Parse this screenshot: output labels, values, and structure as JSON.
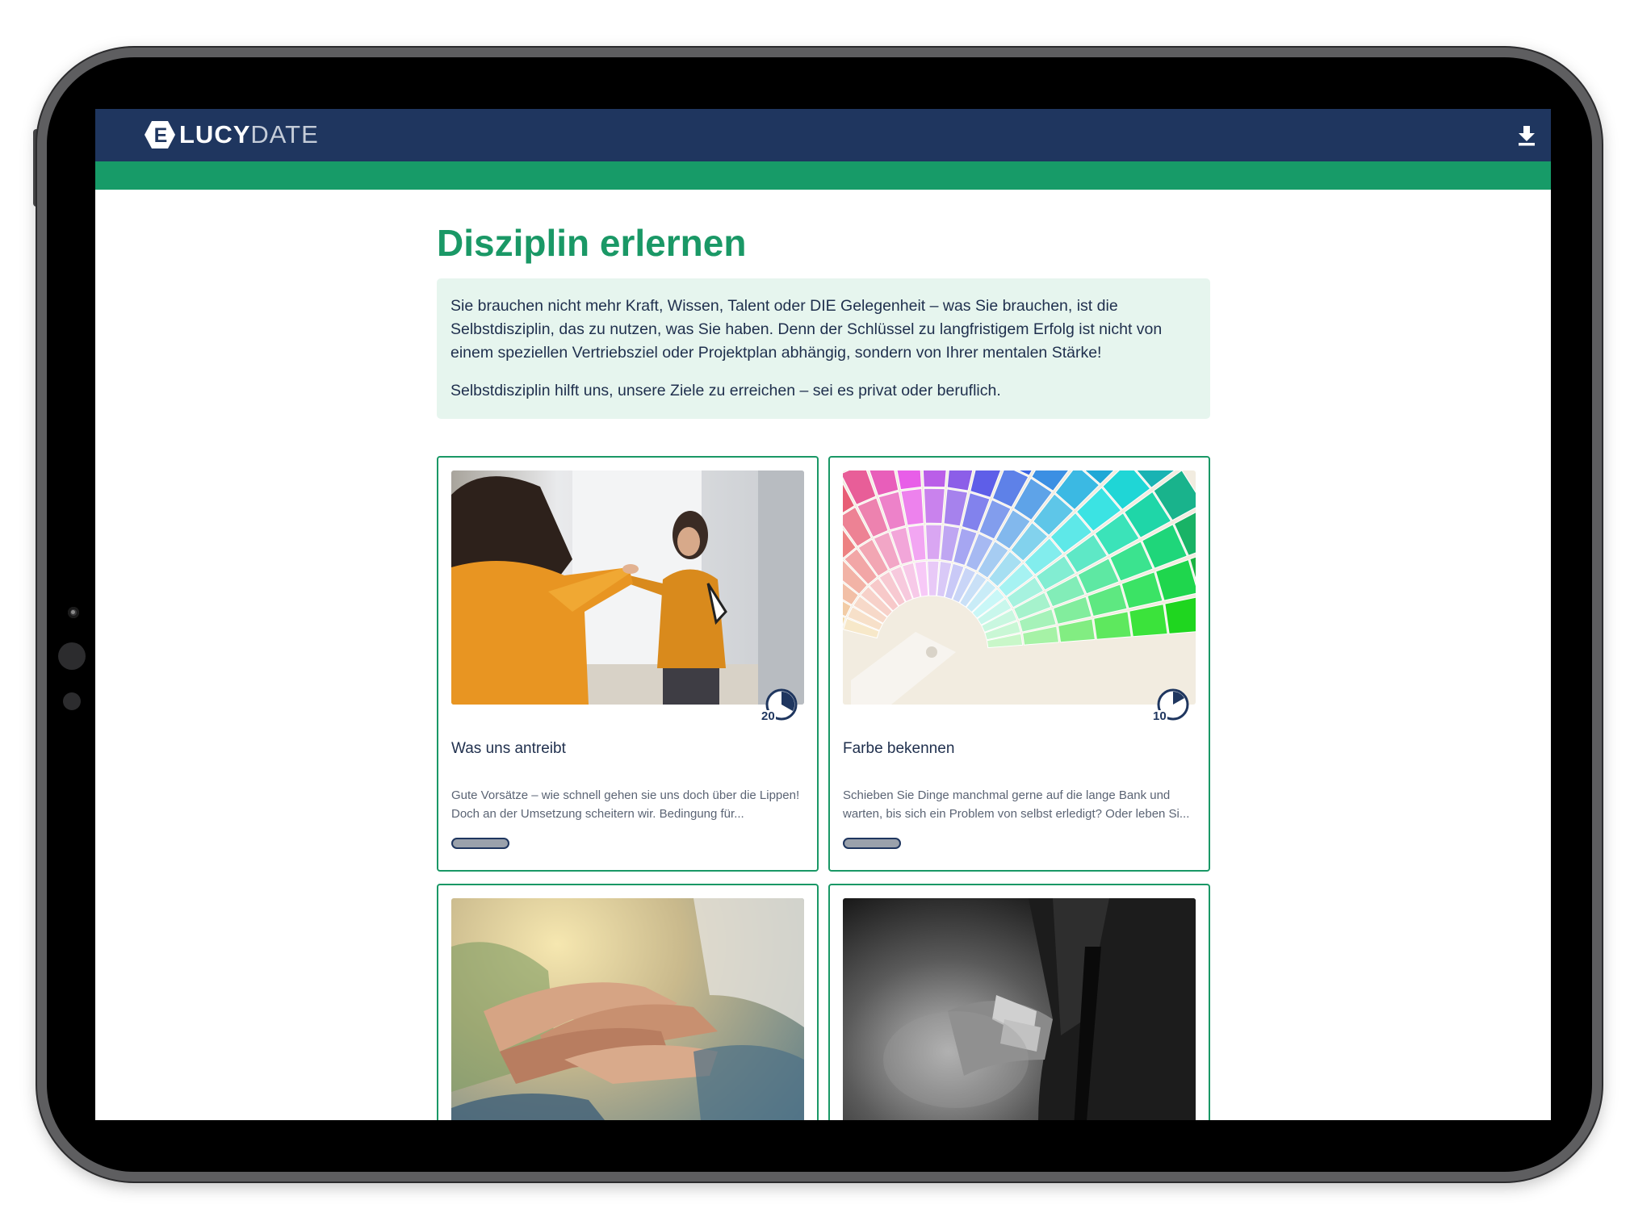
{
  "header": {
    "logo_letter": "E",
    "logo_part1": "LUCY",
    "logo_part2": "DATE",
    "download_icon": "download-icon"
  },
  "colors": {
    "header_bg": "#1f365f",
    "accent_green": "#179b68",
    "intro_bg": "#e6f5ee",
    "text_dark": "#1f2f4d"
  },
  "page": {
    "title": "Disziplin erlernen",
    "intro": [
      "Sie brauchen nicht mehr Kraft, Wissen, Talent oder DIE Gelegenheit – was Sie brauchen, ist die Selbstdisziplin, das zu nutzen, was Sie haben. Denn der Schlüssel zu langfristigem Erfolg ist nicht von einem speziellen Vertriebsziel oder Projektplan abhängig, sondern von Ihrer mentalen Stärke!",
      "Selbstdisziplin hilft uns, unsere Ziele zu erreichen – sei es privat oder beruflich."
    ]
  },
  "cards": [
    {
      "title": "Was uns antreibt",
      "description": "Gute Vorsätze – wie schnell gehen sie uns doch über die Lippen! Doch an der Umsetzung scheitern wir. Bedingung für...",
      "duration": "20",
      "image": "woman-pointing-at-mirror"
    },
    {
      "title": "Farbe bekennen",
      "description": "Schieben Sie Dinge manchmal gerne auf die lange Bank und warten, bis sich ein Problem von selbst erledigt? Oder leben Si...",
      "duration": "10",
      "image": "color-fan-palette"
    },
    {
      "image": "stacked-hands-team"
    },
    {
      "image": "martial-artist-bowing"
    }
  ]
}
